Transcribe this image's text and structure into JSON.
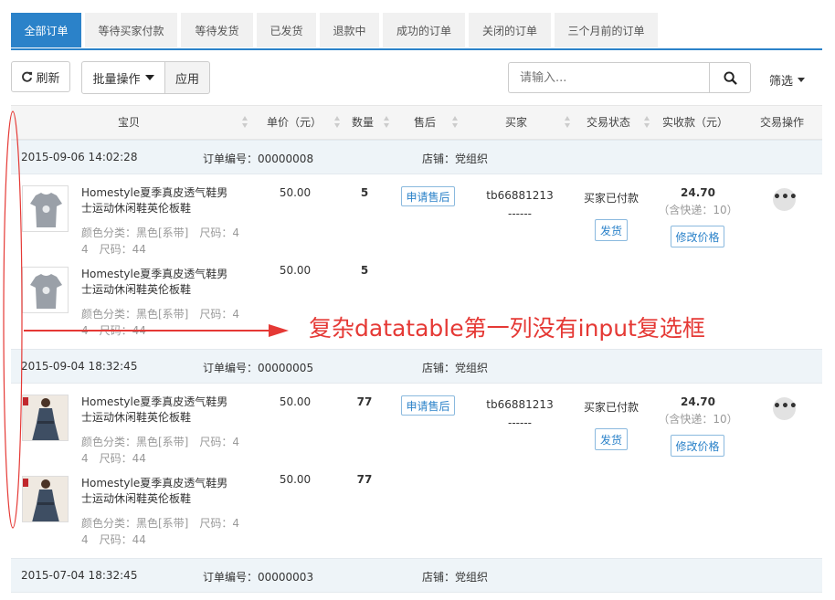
{
  "tabs": [
    {
      "label": "全部订单",
      "active": true
    },
    {
      "label": "等待买家付款",
      "active": false
    },
    {
      "label": "等待发货",
      "active": false
    },
    {
      "label": "已发货",
      "active": false
    },
    {
      "label": "退款中",
      "active": false
    },
    {
      "label": "成功的订单",
      "active": false
    },
    {
      "label": "关闭的订单",
      "active": false
    },
    {
      "label": "三个月前的订单",
      "active": false
    }
  ],
  "toolbar": {
    "refresh_label": "刷新",
    "batch_label": "批量操作",
    "apply_label": "应用",
    "filter_label": "筛选"
  },
  "search": {
    "placeholder": "请输入..."
  },
  "columns": {
    "item": "宝贝",
    "price": "单价（元）",
    "qty": "数量",
    "aftersale": "售后",
    "buyer": "买家",
    "status": "交易状态",
    "paid": "实收款（元）",
    "action": "交易操作"
  },
  "groups": [
    {
      "time": "2015-09-06 14:02:28",
      "order_no": "订单编号：00000008",
      "shop": "店铺：党组织",
      "buyer": "tb66881213",
      "buyer_sub": "------",
      "status": "买家已付款",
      "total": "24.70",
      "ship": "（含快递：10）",
      "aftersale_btn": "申请售后",
      "ship_btn": "发货",
      "edit_btn": "修改价格",
      "more": "•••",
      "items": [
        {
          "name": "Homestyle夏季真皮透气鞋男士运动休闲鞋英伦板鞋",
          "attr": "颜色分类：黑色[系带]　尺码：4 4　尺码：44",
          "price": "50.00",
          "qty": "5"
        },
        {
          "name": "Homestyle夏季真皮透气鞋男士运动休闲鞋英伦板鞋",
          "attr": "颜色分类：黑色[系带]　尺码：4 4　尺码：44",
          "price": "50.00",
          "qty": "5"
        }
      ]
    },
    {
      "time": "2015-09-04 18:32:45",
      "order_no": "订单编号：00000005",
      "shop": "店铺：党组织",
      "buyer": "tb66881213",
      "buyer_sub": "------",
      "status": "买家已付款",
      "total": "24.70",
      "ship": "（含快递：10）",
      "aftersale_btn": "申请售后",
      "ship_btn": "发货",
      "edit_btn": "修改价格",
      "more": "•••",
      "items": [
        {
          "name": "Homestyle夏季真皮透气鞋男士运动休闲鞋英伦板鞋",
          "attr": "颜色分类：黑色[系带]　尺码：4 4　尺码：44",
          "price": "50.00",
          "qty": "77"
        },
        {
          "name": "Homestyle夏季真皮透气鞋男士运动休闲鞋英伦板鞋",
          "attr": "颜色分类：黑色[系带]　尺码：4 4　尺码：44",
          "price": "50.00",
          "qty": "77"
        }
      ]
    },
    {
      "time": "2015-07-04 18:32:45",
      "order_no": "订单编号：00000003",
      "shop": "店铺：党组织"
    }
  ],
  "annotation": {
    "text": "复杂datatable第一列没有input复选框",
    "color": "#e53935"
  },
  "colors": {
    "accent": "#2b82c9",
    "group_header": "#eef4f8"
  }
}
